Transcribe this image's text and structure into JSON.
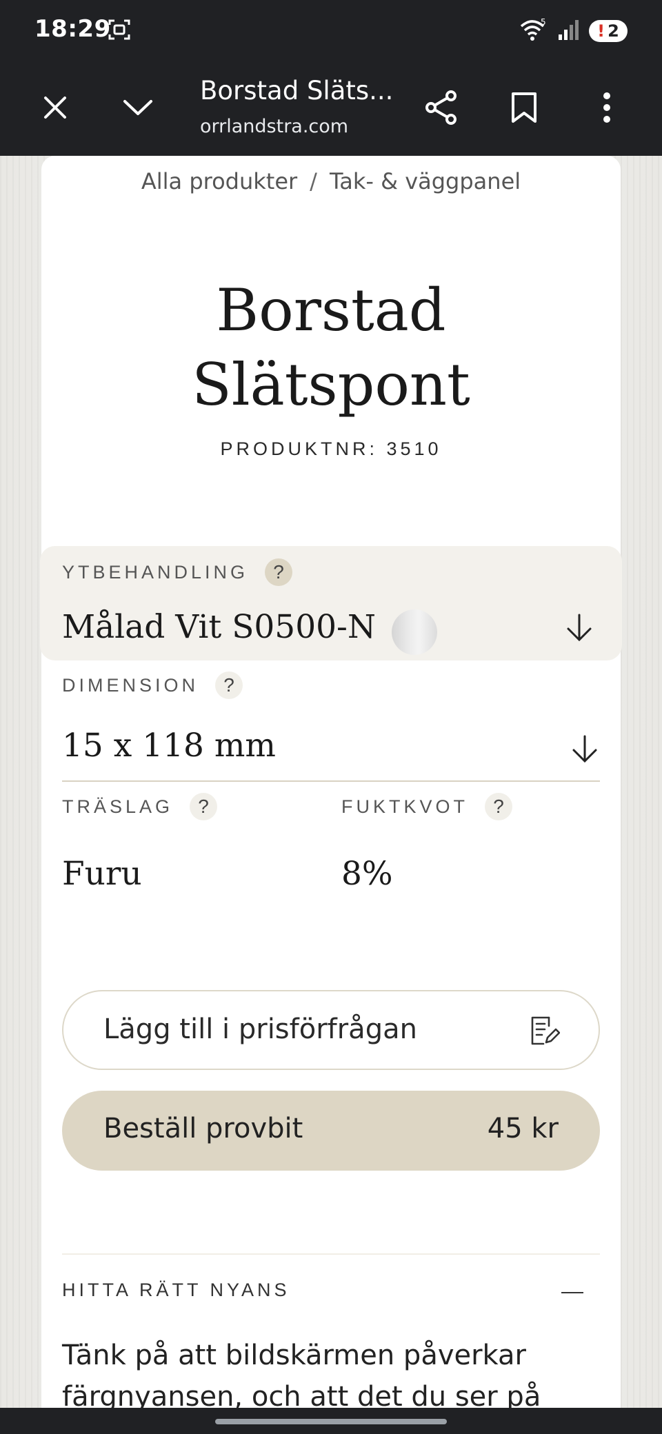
{
  "status_bar": {
    "time": "18:29",
    "wifi_label": "5",
    "notification_count": "2",
    "notification_mark": "!"
  },
  "browser": {
    "page_title": "Borstad Släts...",
    "url": "orrlandstra.com",
    "icons": [
      "close-icon",
      "chevron-down-icon",
      "share-icon",
      "bookmark-icon",
      "more-vert-icon"
    ]
  },
  "breadcrumb": {
    "items": [
      "Alla produkter",
      "Tak- & väggpanel"
    ],
    "separator": "/"
  },
  "product": {
    "title_line1": "Borstad",
    "title_line2": "Slätspont",
    "product_number": "PRODUKTNR: 3510"
  },
  "options": {
    "finish": {
      "label": "YTBEHANDLING",
      "help": "?",
      "value": "Målad Vit S0500-N"
    },
    "dimension": {
      "label": "DIMENSION",
      "help": "?",
      "value": "15 x 118 mm"
    },
    "wood": {
      "label": "TRÄSLAG",
      "help": "?",
      "value": "Furu"
    },
    "moisture": {
      "label": "FUKTKVOT",
      "help": "?",
      "value": "8%"
    }
  },
  "actions": {
    "add_to_quote": "Lägg till i prisförfrågan",
    "order_sample": "Beställ provbit",
    "sample_price": "45 kr"
  },
  "accordion": {
    "title": "HITTA RÄTT NYANS",
    "body": "Tänk på att bildskärmen påverkar färgnyansen, och att det du ser på"
  },
  "colors": {
    "toolbar_bg": "#202124",
    "accent_beige": "#ddd6c4",
    "finish_bg": "#f3f1ec"
  }
}
